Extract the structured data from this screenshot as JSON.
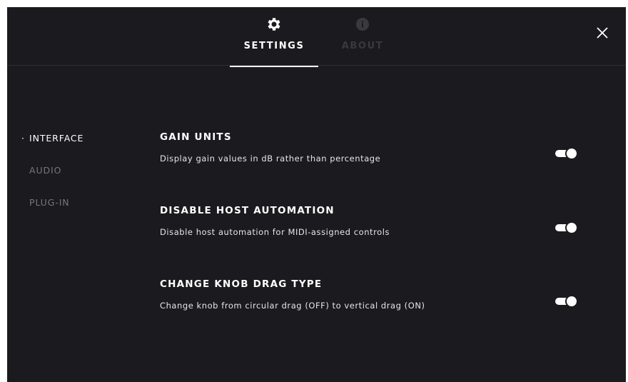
{
  "tabs": {
    "settings": {
      "label": "SETTINGS",
      "icon": "gear-icon",
      "active": true
    },
    "about": {
      "label": "ABOUT",
      "icon": "info-icon",
      "active": false
    }
  },
  "close": {
    "icon": "close-icon"
  },
  "sidebar": {
    "items": [
      {
        "label": "INTERFACE",
        "active": true
      },
      {
        "label": "AUDIO",
        "active": false
      },
      {
        "label": "PLUG-IN",
        "active": false
      }
    ]
  },
  "settings": [
    {
      "title": "GAIN UNITS",
      "description": "Display gain values in dB rather than percentage",
      "enabled": true
    },
    {
      "title": "DISABLE HOST AUTOMATION",
      "description": "Disable host automation for MIDI-assigned controls",
      "enabled": true
    },
    {
      "title": "CHANGE KNOB DRAG TYPE",
      "description": "Change knob from circular drag (OFF) to vertical drag (ON)",
      "enabled": true
    }
  ],
  "colors": {
    "background": "#1b1a1e",
    "active_text": "#ffffff",
    "inactive_text": "#76767c",
    "disabled_tab": "#3a393e"
  }
}
